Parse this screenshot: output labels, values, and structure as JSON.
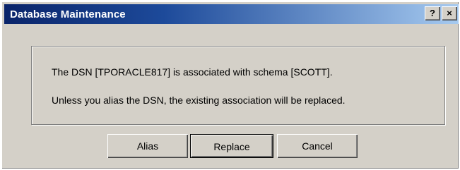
{
  "window": {
    "title": "Database Maintenance",
    "help_label": "?",
    "close_label": "×"
  },
  "message": {
    "line1": "The DSN [TPORACLE817] is associated with schema [SCOTT].",
    "line2": "Unless you alias the DSN, the existing association will be replaced."
  },
  "buttons": {
    "alias": "Alias",
    "replace": "Replace",
    "cancel": "Cancel"
  },
  "colors": {
    "titlebar_start": "#0a246a",
    "titlebar_end": "#a6caf0",
    "face": "#d4d0c8"
  }
}
